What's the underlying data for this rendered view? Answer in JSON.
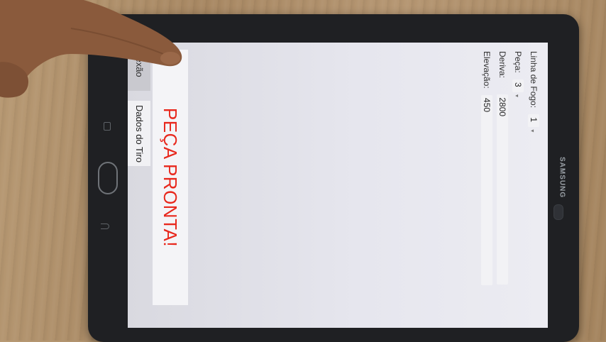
{
  "device": {
    "brand": "SAMSUNG"
  },
  "app": {
    "tabs": [
      {
        "label": "Conexão",
        "visible_label": "onexão"
      },
      {
        "label": "Dados do Tiro"
      }
    ],
    "status": "PEÇA PRONTA!",
    "fields": [
      {
        "label": "Linha de Fogo:",
        "value": "1"
      },
      {
        "label": "Peça:",
        "value": "3"
      },
      {
        "label": "Deriva:",
        "value": "2800"
      },
      {
        "label": "Elevação:",
        "value": "450"
      }
    ]
  },
  "colors": {
    "status_text": "#e8281d",
    "screen_bg": "#e6e6ee",
    "bezel": "#1f2023"
  }
}
